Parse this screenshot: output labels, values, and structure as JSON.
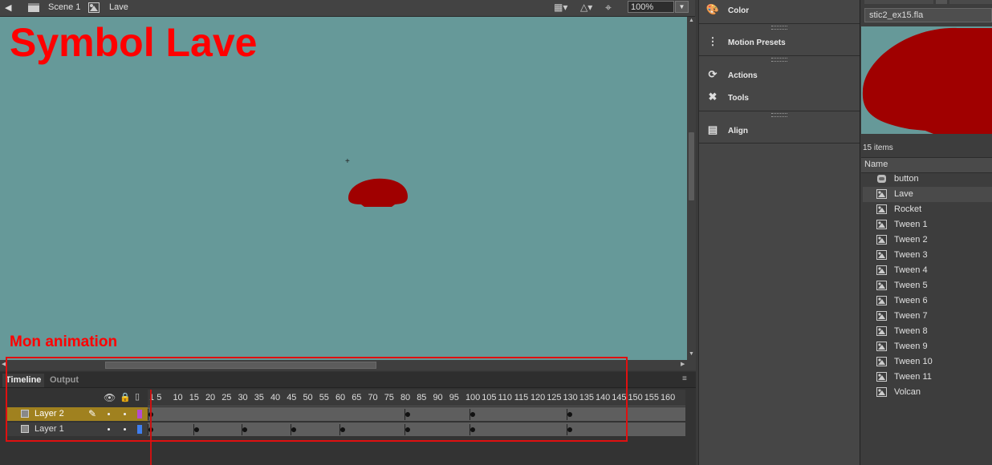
{
  "editbar": {
    "scene_label": "Scene 1",
    "symbol_label": "Lave",
    "zoom_value": "100%"
  },
  "stage": {
    "overlay_title": "Symbol Lave",
    "overlay_label": "Mon animation",
    "background": "#669999",
    "shape_color": "#a00000"
  },
  "timeline": {
    "tabs": [
      "Timeline",
      "Output"
    ],
    "ruler_labels": [
      "1",
      "5",
      "10",
      "15",
      "20",
      "25",
      "30",
      "35",
      "40",
      "45",
      "50",
      "55",
      "60",
      "65",
      "70",
      "75",
      "80",
      "85",
      "90",
      "95",
      "100",
      "105",
      "110",
      "115",
      "120",
      "125",
      "130",
      "135",
      "140",
      "145",
      "150",
      "155",
      "160"
    ],
    "layers": [
      {
        "name": "Layer 2",
        "keyframes": [
          1,
          80,
          100,
          130
        ],
        "color": "#b44bd0"
      },
      {
        "name": "Layer 1",
        "keyframes": [
          1,
          15,
          30,
          45,
          60,
          80,
          100,
          130
        ],
        "color": "#3f7ff0"
      }
    ],
    "current_frame": 1
  },
  "panels": {
    "color": "Color",
    "motion_presets": "Motion Presets",
    "actions": "Actions",
    "tools": "Tools",
    "align": "Align"
  },
  "library": {
    "file": "stic2_ex15.fla",
    "count_label": "15 items",
    "column_name": "Name",
    "items": [
      {
        "label": "button",
        "icon": "button-icon"
      },
      {
        "label": "Lave",
        "icon": "graphic-icon",
        "selected": true
      },
      {
        "label": "Rocket",
        "icon": "graphic-icon"
      },
      {
        "label": "Tween 1",
        "icon": "graphic-icon"
      },
      {
        "label": "Tween 2",
        "icon": "graphic-icon"
      },
      {
        "label": "Tween 3",
        "icon": "graphic-icon"
      },
      {
        "label": "Tween 4",
        "icon": "graphic-icon"
      },
      {
        "label": "Tween 5",
        "icon": "graphic-icon"
      },
      {
        "label": "Tween 6",
        "icon": "graphic-icon"
      },
      {
        "label": "Tween 7",
        "icon": "graphic-icon"
      },
      {
        "label": "Tween 8",
        "icon": "graphic-icon"
      },
      {
        "label": "Tween 9",
        "icon": "graphic-icon"
      },
      {
        "label": "Tween 10",
        "icon": "graphic-icon"
      },
      {
        "label": "Tween 11",
        "icon": "graphic-icon"
      },
      {
        "label": "Volcan",
        "icon": "graphic-icon"
      }
    ]
  }
}
